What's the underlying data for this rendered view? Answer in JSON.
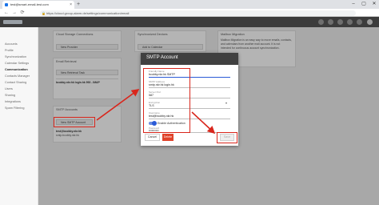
{
  "browser": {
    "tab_title": "test@smart-email-test.com",
    "new_tab": "+",
    "address": "https://cloud.group-alarm.de/settings/communication/email",
    "window_controls": [
      "–",
      "▢",
      "✕"
    ],
    "nav": [
      "←",
      "→",
      "⟳"
    ]
  },
  "sidebar": {
    "items": [
      {
        "label": "Accounts"
      },
      {
        "label": "Profile"
      },
      {
        "label": "Synchronization"
      },
      {
        "label": "Calendar Settings"
      },
      {
        "label": "Communication"
      },
      {
        "label": "Contacts Manager"
      },
      {
        "label": "Contact Sharing"
      },
      {
        "label": "Users"
      },
      {
        "label": "Sharing"
      },
      {
        "label": "Integrations"
      },
      {
        "label": "Spam Filtering"
      }
    ]
  },
  "panels": {
    "cloud": {
      "title": "Cloud Storage Connections",
      "button": "New Provider"
    },
    "sync": {
      "title": "Synchronized Devices",
      "button": "Add to Calendar"
    },
    "mailbox": {
      "title": "Mailbox Migration",
      "text": [
        "Mailbox Migration is an easy way to move emails, contacts,",
        "and calendars from another mail account. It is not",
        "intended for continuous account synchronization."
      ]
    },
    "email_retrieval": {
      "title": "Email Retrieval",
      "button": "New Retrieval Task",
      "item": "bcobby.nkr.hk login.hk 993 - IMAP"
    },
    "smtp": {
      "title": "SMTP Accounts",
      "button": "New SMTP Account",
      "item_title": "test@bcobby.nkr.hk",
      "item_sub": "smtp.bcobby.nkr.hk"
    }
  },
  "modal": {
    "title": "SMTP Account",
    "fields": [
      {
        "label": "Friendly Name",
        "value": "bcobby.nkr.hk SMTP"
      },
      {
        "label": "SMTP Address",
        "value": "smtp.nkr.hk login.hk"
      },
      {
        "label": "Server Port",
        "value": "587"
      },
      {
        "label": "Encryption",
        "value": "TLS"
      },
      {
        "label": "Username",
        "value": "test@bcobby.nkr.hk"
      },
      {
        "label": "Password",
        "value": "••••••••••"
      }
    ],
    "toggle_label": "Enable Authentication",
    "toggle_on": true,
    "cancel": "Cancel",
    "delete": "Delete",
    "save": "Save"
  },
  "colors": {
    "highlight": "#d9261c",
    "header": "#3c3c3c",
    "delete": "#e0432b",
    "toggle": "#2b5bd7"
  }
}
